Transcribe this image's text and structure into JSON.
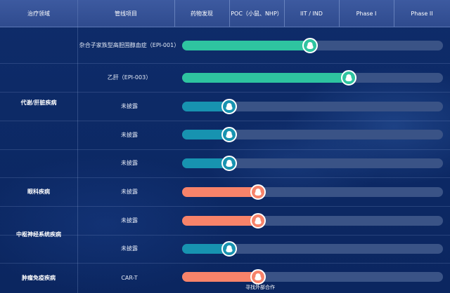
{
  "header": {
    "columns": [
      "治疗领域",
      "管线项目",
      "药物发现",
      "POC（小鼠、NHP）",
      "IIT / IND",
      "Phase I",
      "Phase II"
    ]
  },
  "areas": [
    "代谢/肝脏疾病",
    "眼科疾病",
    "中枢神经系统疾病",
    "肿瘤免疫疾病"
  ],
  "rows": [
    {
      "project": "杂合子家族型高胆固醇血症（EPI-001）",
      "progress": 0.49,
      "color": "teal"
    },
    {
      "project": "乙肝（EPI-003）",
      "progress": 0.64,
      "color": "teal"
    },
    {
      "project": "未披露",
      "progress": 0.18,
      "color": "blue"
    },
    {
      "project": "未披露",
      "progress": 0.18,
      "color": "blue"
    },
    {
      "project": "未披露",
      "progress": 0.18,
      "color": "blue"
    },
    {
      "project": "未披露",
      "progress": 0.29,
      "color": "orange"
    },
    {
      "project": "未披露",
      "progress": 0.29,
      "color": "orange"
    },
    {
      "project": "未披露",
      "progress": 0.18,
      "color": "blue"
    },
    {
      "project": "CAR-T",
      "progress": 0.29,
      "color": "orange"
    }
  ],
  "note": "寻找外部合作",
  "colors": {
    "teal": "#2ec4a0",
    "blue": "#1793b0",
    "orange": "#f7836a",
    "track": "#3a5386",
    "header": "#3a57a0",
    "background": "#0d2a66"
  }
}
